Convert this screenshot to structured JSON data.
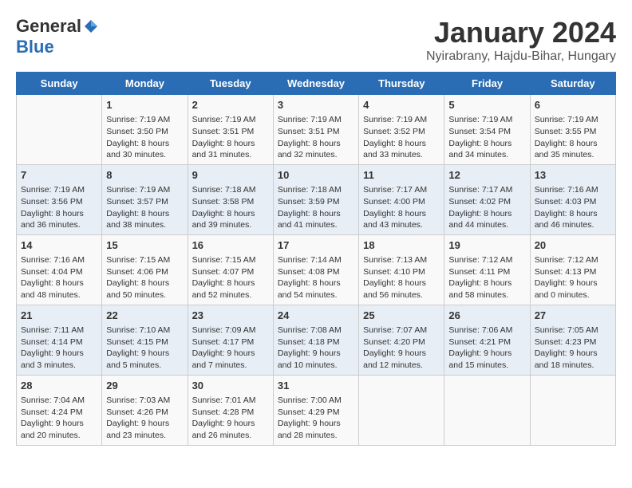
{
  "header": {
    "logo_general": "General",
    "logo_blue": "Blue",
    "month_year": "January 2024",
    "location": "Nyirabrany, Hajdu-Bihar, Hungary"
  },
  "weekdays": [
    "Sunday",
    "Monday",
    "Tuesday",
    "Wednesday",
    "Thursday",
    "Friday",
    "Saturday"
  ],
  "weeks": [
    [
      {
        "day": "",
        "info": ""
      },
      {
        "day": "1",
        "info": "Sunrise: 7:19 AM\nSunset: 3:50 PM\nDaylight: 8 hours\nand 30 minutes."
      },
      {
        "day": "2",
        "info": "Sunrise: 7:19 AM\nSunset: 3:51 PM\nDaylight: 8 hours\nand 31 minutes."
      },
      {
        "day": "3",
        "info": "Sunrise: 7:19 AM\nSunset: 3:51 PM\nDaylight: 8 hours\nand 32 minutes."
      },
      {
        "day": "4",
        "info": "Sunrise: 7:19 AM\nSunset: 3:52 PM\nDaylight: 8 hours\nand 33 minutes."
      },
      {
        "day": "5",
        "info": "Sunrise: 7:19 AM\nSunset: 3:54 PM\nDaylight: 8 hours\nand 34 minutes."
      },
      {
        "day": "6",
        "info": "Sunrise: 7:19 AM\nSunset: 3:55 PM\nDaylight: 8 hours\nand 35 minutes."
      }
    ],
    [
      {
        "day": "7",
        "info": "Sunrise: 7:19 AM\nSunset: 3:56 PM\nDaylight: 8 hours\nand 36 minutes."
      },
      {
        "day": "8",
        "info": "Sunrise: 7:19 AM\nSunset: 3:57 PM\nDaylight: 8 hours\nand 38 minutes."
      },
      {
        "day": "9",
        "info": "Sunrise: 7:18 AM\nSunset: 3:58 PM\nDaylight: 8 hours\nand 39 minutes."
      },
      {
        "day": "10",
        "info": "Sunrise: 7:18 AM\nSunset: 3:59 PM\nDaylight: 8 hours\nand 41 minutes."
      },
      {
        "day": "11",
        "info": "Sunrise: 7:17 AM\nSunset: 4:00 PM\nDaylight: 8 hours\nand 43 minutes."
      },
      {
        "day": "12",
        "info": "Sunrise: 7:17 AM\nSunset: 4:02 PM\nDaylight: 8 hours\nand 44 minutes."
      },
      {
        "day": "13",
        "info": "Sunrise: 7:16 AM\nSunset: 4:03 PM\nDaylight: 8 hours\nand 46 minutes."
      }
    ],
    [
      {
        "day": "14",
        "info": "Sunrise: 7:16 AM\nSunset: 4:04 PM\nDaylight: 8 hours\nand 48 minutes."
      },
      {
        "day": "15",
        "info": "Sunrise: 7:15 AM\nSunset: 4:06 PM\nDaylight: 8 hours\nand 50 minutes."
      },
      {
        "day": "16",
        "info": "Sunrise: 7:15 AM\nSunset: 4:07 PM\nDaylight: 8 hours\nand 52 minutes."
      },
      {
        "day": "17",
        "info": "Sunrise: 7:14 AM\nSunset: 4:08 PM\nDaylight: 8 hours\nand 54 minutes."
      },
      {
        "day": "18",
        "info": "Sunrise: 7:13 AM\nSunset: 4:10 PM\nDaylight: 8 hours\nand 56 minutes."
      },
      {
        "day": "19",
        "info": "Sunrise: 7:12 AM\nSunset: 4:11 PM\nDaylight: 8 hours\nand 58 minutes."
      },
      {
        "day": "20",
        "info": "Sunrise: 7:12 AM\nSunset: 4:13 PM\nDaylight: 9 hours\nand 0 minutes."
      }
    ],
    [
      {
        "day": "21",
        "info": "Sunrise: 7:11 AM\nSunset: 4:14 PM\nDaylight: 9 hours\nand 3 minutes."
      },
      {
        "day": "22",
        "info": "Sunrise: 7:10 AM\nSunset: 4:15 PM\nDaylight: 9 hours\nand 5 minutes."
      },
      {
        "day": "23",
        "info": "Sunrise: 7:09 AM\nSunset: 4:17 PM\nDaylight: 9 hours\nand 7 minutes."
      },
      {
        "day": "24",
        "info": "Sunrise: 7:08 AM\nSunset: 4:18 PM\nDaylight: 9 hours\nand 10 minutes."
      },
      {
        "day": "25",
        "info": "Sunrise: 7:07 AM\nSunset: 4:20 PM\nDaylight: 9 hours\nand 12 minutes."
      },
      {
        "day": "26",
        "info": "Sunrise: 7:06 AM\nSunset: 4:21 PM\nDaylight: 9 hours\nand 15 minutes."
      },
      {
        "day": "27",
        "info": "Sunrise: 7:05 AM\nSunset: 4:23 PM\nDaylight: 9 hours\nand 18 minutes."
      }
    ],
    [
      {
        "day": "28",
        "info": "Sunrise: 7:04 AM\nSunset: 4:24 PM\nDaylight: 9 hours\nand 20 minutes."
      },
      {
        "day": "29",
        "info": "Sunrise: 7:03 AM\nSunset: 4:26 PM\nDaylight: 9 hours\nand 23 minutes."
      },
      {
        "day": "30",
        "info": "Sunrise: 7:01 AM\nSunset: 4:28 PM\nDaylight: 9 hours\nand 26 minutes."
      },
      {
        "day": "31",
        "info": "Sunrise: 7:00 AM\nSunset: 4:29 PM\nDaylight: 9 hours\nand 28 minutes."
      },
      {
        "day": "",
        "info": ""
      },
      {
        "day": "",
        "info": ""
      },
      {
        "day": "",
        "info": ""
      }
    ]
  ]
}
